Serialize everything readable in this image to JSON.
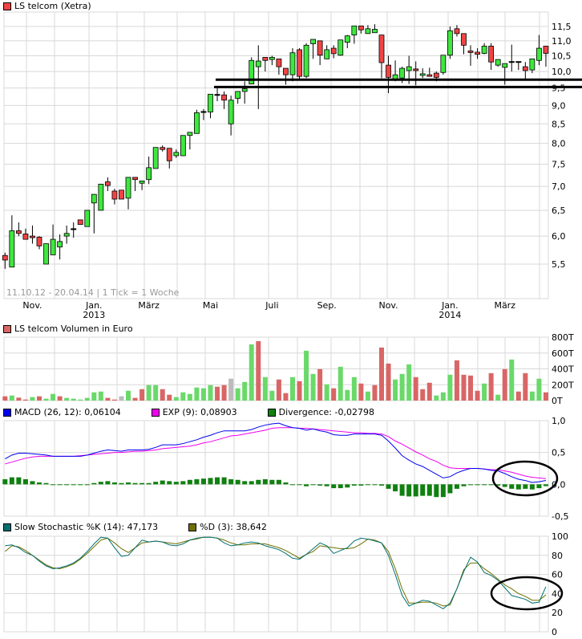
{
  "colors": {
    "up": "#3ee83e",
    "down": "#f04444",
    "vol_up": "#6ad96a",
    "vol_down": "#d96666",
    "vol_neutral": "#bbbbbb",
    "grid": "#d8d8d8",
    "macd": "#0000ee",
    "signal": "#ee00ee",
    "divergence": "#108010",
    "stoch_k": "#007070",
    "stoch_d": "#707000"
  },
  "chart_data": [
    {
      "type": "candlestick",
      "title": "LS telcom (Xetra)",
      "scale": "log",
      "ylim": [
        4.94,
        12.03
      ],
      "yticks": [
        "11,5",
        "11,0",
        "10,5",
        "10,0",
        "9,5",
        "9,0",
        "8,5",
        "8,0",
        "7,5",
        "7,0",
        "6,5",
        "6,0",
        "5,5"
      ],
      "ytick_values": [
        11.5,
        11.0,
        10.5,
        10.0,
        9.5,
        9.0,
        8.5,
        8.0,
        7.5,
        7.0,
        6.5,
        6.0,
        5.5
      ],
      "x_labels": [
        [
          "Nov.",
          ""
        ],
        [
          "Jan.",
          "2013"
        ],
        [
          "März",
          ""
        ],
        [
          "Mai",
          ""
        ],
        [
          "Juli",
          ""
        ],
        [
          "Sep.",
          ""
        ],
        [
          "Nov.",
          ""
        ],
        [
          "Jan.",
          "2014"
        ],
        [
          "März",
          ""
        ]
      ],
      "x_label_weeks": [
        4,
        13,
        21,
        30,
        39,
        47,
        56,
        65,
        73
      ],
      "range_note": "11.10.12 - 20.04.14 | 1 Tick = 1 Woche",
      "grid": true,
      "support_lines": [
        9.75,
        9.53
      ],
      "ohlc": [
        [
          5.65,
          5.7,
          5.42,
          5.57
        ],
        [
          5.45,
          6.4,
          5.45,
          6.1
        ],
        [
          6.1,
          6.26,
          6.0,
          6.05
        ],
        [
          6.04,
          6.14,
          5.94,
          5.94
        ],
        [
          6.0,
          6.2,
          5.86,
          5.98
        ],
        [
          5.98,
          6.0,
          5.76,
          5.82
        ],
        [
          5.5,
          5.86,
          5.5,
          5.86
        ],
        [
          5.66,
          6.22,
          5.66,
          5.94
        ],
        [
          5.8,
          6.03,
          5.58,
          5.9
        ],
        [
          6.0,
          6.2,
          5.86,
          6.05
        ],
        [
          6.13,
          6.26,
          5.97,
          6.13
        ],
        [
          6.31,
          6.31,
          6.22,
          6.22
        ],
        [
          6.18,
          6.5,
          6.18,
          6.5
        ],
        [
          6.65,
          6.83,
          6.05,
          6.83
        ],
        [
          6.5,
          7.05,
          6.5,
          7.05
        ],
        [
          7.1,
          7.2,
          6.9,
          7.02
        ],
        [
          6.9,
          6.95,
          6.62,
          6.73
        ],
        [
          6.92,
          6.92,
          6.73,
          6.73
        ],
        [
          6.75,
          7.2,
          6.52,
          7.2
        ],
        [
          7.2,
          7.2,
          6.9,
          7.15
        ],
        [
          7.07,
          7.12,
          6.92,
          7.12
        ],
        [
          7.15,
          7.68,
          7.05,
          7.42
        ],
        [
          7.4,
          7.9,
          7.4,
          7.9
        ],
        [
          7.9,
          7.95,
          7.8,
          7.85
        ],
        [
          7.88,
          7.88,
          7.4,
          7.58
        ],
        [
          7.7,
          7.85,
          7.65,
          7.78
        ],
        [
          7.7,
          8.2,
          7.7,
          8.2
        ],
        [
          8.2,
          8.28,
          7.85,
          8.28
        ],
        [
          8.25,
          8.88,
          8.25,
          8.8
        ],
        [
          8.82,
          8.9,
          8.6,
          8.82
        ],
        [
          8.82,
          9.32,
          8.65,
          9.32
        ],
        [
          9.3,
          9.5,
          9.12,
          9.3
        ],
        [
          9.3,
          9.4,
          8.9,
          9.15
        ],
        [
          8.5,
          9.28,
          8.2,
          9.15
        ],
        [
          9.2,
          9.4,
          9.05,
          9.4
        ],
        [
          9.4,
          9.7,
          9.05,
          9.48
        ],
        [
          9.62,
          10.45,
          9.62,
          10.35
        ],
        [
          10.15,
          10.85,
          8.9,
          10.33
        ],
        [
          10.45,
          10.45,
          10.0,
          10.35
        ],
        [
          10.38,
          10.5,
          10.2,
          10.45
        ],
        [
          10.4,
          10.4,
          9.9,
          10.15
        ],
        [
          10.1,
          10.1,
          9.6,
          9.9
        ],
        [
          9.9,
          10.75,
          9.7,
          10.6
        ],
        [
          10.7,
          10.75,
          9.78,
          9.85
        ],
        [
          9.85,
          10.92,
          9.8,
          10.85
        ],
        [
          10.9,
          11.05,
          10.4,
          11.05
        ],
        [
          11.0,
          11.0,
          10.2,
          10.52
        ],
        [
          10.4,
          10.85,
          10.4,
          10.7
        ],
        [
          10.75,
          10.85,
          10.42,
          10.57
        ],
        [
          10.52,
          11.03,
          10.5,
          11.03
        ],
        [
          10.95,
          11.2,
          10.75,
          11.17
        ],
        [
          11.2,
          11.52,
          10.9,
          11.52
        ],
        [
          11.52,
          11.52,
          11.25,
          11.38
        ],
        [
          11.25,
          11.55,
          11.25,
          11.42
        ],
        [
          11.28,
          11.58,
          11.28,
          11.4
        ],
        [
          11.2,
          11.2,
          9.8,
          10.28
        ],
        [
          10.2,
          10.5,
          9.35,
          9.82
        ],
        [
          9.75,
          10.35,
          9.7,
          9.9
        ],
        [
          9.8,
          10.15,
          9.65,
          10.1
        ],
        [
          10.03,
          10.5,
          9.62,
          10.15
        ],
        [
          10.08,
          10.32,
          9.58,
          10.03
        ],
        [
          9.88,
          10.1,
          9.8,
          9.93
        ],
        [
          9.9,
          10.12,
          9.85,
          9.85
        ],
        [
          9.95,
          10.0,
          9.7,
          9.82
        ],
        [
          9.97,
          10.52,
          9.9,
          10.52
        ],
        [
          10.52,
          11.5,
          10.4,
          11.35
        ],
        [
          11.42,
          11.55,
          11.15,
          11.25
        ],
        [
          11.25,
          11.25,
          10.55,
          10.85
        ],
        [
          10.66,
          10.85,
          10.18,
          10.62
        ],
        [
          10.62,
          10.75,
          10.4,
          10.55
        ],
        [
          10.58,
          10.92,
          10.55,
          10.82
        ],
        [
          10.82,
          10.92,
          10.05,
          10.3
        ],
        [
          10.2,
          10.38,
          10.15,
          10.38
        ],
        [
          10.13,
          10.25,
          9.6,
          10.25
        ],
        [
          10.3,
          10.87,
          10.0,
          10.3
        ],
        [
          10.3,
          10.3,
          10.05,
          10.3
        ],
        [
          10.15,
          10.3,
          9.78,
          10.03
        ],
        [
          10.05,
          10.4,
          9.95,
          10.4
        ],
        [
          10.35,
          11.2,
          10.2,
          10.75
        ],
        [
          10.82,
          10.82,
          10.15,
          10.58
        ]
      ]
    },
    {
      "type": "bar",
      "title": "LS telcom Volumen in Euro",
      "ylim": [
        0,
        800
      ],
      "yticks": [
        "800T",
        "600T",
        "400T",
        "200T",
        "0T"
      ],
      "ytick_values": [
        800,
        600,
        400,
        200,
        0
      ],
      "grid": true,
      "values": [
        54,
        64,
        37,
        13,
        44,
        54,
        24,
        84,
        54,
        34,
        24,
        13,
        34,
        104,
        114,
        34,
        13,
        54,
        124,
        34,
        144,
        195,
        195,
        144,
        74,
        44,
        104,
        84,
        165,
        155,
        195,
        175,
        195,
        276,
        155,
        235,
        709,
        750,
        296,
        124,
        266,
        94,
        296,
        245,
        629,
        336,
        397,
        205,
        155,
        427,
        134,
        296,
        215,
        114,
        195,
        669,
        467,
        266,
        336,
        457,
        296,
        144,
        225,
        64,
        104,
        326,
        508,
        326,
        316,
        124,
        215,
        346,
        74,
        397,
        518,
        114,
        346,
        114,
        276,
        104
      ],
      "directions": [
        "down",
        "up",
        "down",
        "down",
        "up",
        "down",
        "up",
        "up",
        "down",
        "up",
        "up",
        "up",
        "up",
        "up",
        "up",
        "down",
        "down",
        "neutral",
        "up",
        "down",
        "down",
        "up",
        "up",
        "down",
        "down",
        "up",
        "up",
        "up",
        "up",
        "up",
        "up",
        "down",
        "down",
        "neutral",
        "up",
        "up",
        "up",
        "down",
        "up",
        "up",
        "down",
        "down",
        "up",
        "down",
        "up",
        "up",
        "down",
        "up",
        "down",
        "up",
        "up",
        "up",
        "down",
        "up",
        "down",
        "down",
        "down",
        "up",
        "up",
        "up",
        "down",
        "down",
        "down",
        "up",
        "up",
        "up",
        "down",
        "down",
        "down",
        "down",
        "up",
        "down",
        "up",
        "down",
        "up",
        "down",
        "down",
        "up",
        "up",
        "down"
      ]
    },
    {
      "type": "line",
      "ylim": [
        -0.5,
        1.0
      ],
      "yticks": [
        "1,0",
        "0,5",
        "0,0",
        "-0,5"
      ],
      "ytick_values": [
        1.0,
        0.5,
        0.0,
        -0.5
      ],
      "grid": true,
      "series": [
        {
          "name": "MACD (26, 12): 0,06104",
          "values": [
            0.4,
            0.46,
            0.49,
            0.49,
            0.48,
            0.47,
            0.46,
            0.44,
            0.44,
            0.44,
            0.44,
            0.44,
            0.46,
            0.49,
            0.52,
            0.54,
            0.53,
            0.52,
            0.54,
            0.54,
            0.54,
            0.55,
            0.58,
            0.62,
            0.62,
            0.62,
            0.64,
            0.67,
            0.7,
            0.74,
            0.77,
            0.81,
            0.84,
            0.84,
            0.84,
            0.84,
            0.86,
            0.9,
            0.93,
            0.95,
            0.96,
            0.92,
            0.89,
            0.88,
            0.85,
            0.87,
            0.84,
            0.82,
            0.78,
            0.77,
            0.77,
            0.79,
            0.79,
            0.79,
            0.79,
            0.77,
            0.68,
            0.57,
            0.45,
            0.38,
            0.32,
            0.28,
            0.22,
            0.16,
            0.1,
            0.12,
            0.18,
            0.22,
            0.25,
            0.25,
            0.24,
            0.22,
            0.21,
            0.17,
            0.12,
            0.08,
            0.06,
            0.03,
            0.04,
            0.061
          ]
        },
        {
          "name": "EXP (9): 0,08903",
          "values": [
            0.32,
            0.35,
            0.38,
            0.41,
            0.43,
            0.44,
            0.44,
            0.44,
            0.44,
            0.44,
            0.44,
            0.45,
            0.46,
            0.47,
            0.48,
            0.49,
            0.5,
            0.5,
            0.51,
            0.52,
            0.52,
            0.53,
            0.54,
            0.56,
            0.57,
            0.58,
            0.59,
            0.6,
            0.62,
            0.65,
            0.67,
            0.7,
            0.73,
            0.76,
            0.77,
            0.79,
            0.81,
            0.83,
            0.85,
            0.88,
            0.89,
            0.89,
            0.89,
            0.88,
            0.88,
            0.87,
            0.86,
            0.85,
            0.84,
            0.83,
            0.82,
            0.81,
            0.81,
            0.8,
            0.8,
            0.79,
            0.75,
            0.68,
            0.63,
            0.57,
            0.51,
            0.46,
            0.4,
            0.36,
            0.3,
            0.26,
            0.25,
            0.25,
            0.25,
            0.25,
            0.24,
            0.23,
            0.23,
            0.21,
            0.19,
            0.16,
            0.13,
            0.11,
            0.1,
            0.089
          ]
        },
        {
          "name": "Divergence: -0,02798",
          "type": "bar",
          "values": [
            0.08,
            0.11,
            0.11,
            0.08,
            0.05,
            0.03,
            0.02,
            0,
            0,
            0,
            0,
            -0.01,
            0,
            0.02,
            0.04,
            0.05,
            0.03,
            0.02,
            0.03,
            0.02,
            0.02,
            0.02,
            0.04,
            0.06,
            0.05,
            0.04,
            0.05,
            0.07,
            0.08,
            0.09,
            0.1,
            0.11,
            0.11,
            0.08,
            0.07,
            0.05,
            0.05,
            0.07,
            0.08,
            0.07,
            0.07,
            0.03,
            0,
            0,
            -0.03,
            0,
            -0.02,
            -0.03,
            -0.06,
            -0.06,
            -0.05,
            -0.02,
            -0.02,
            -0.01,
            -0.01,
            -0.02,
            -0.07,
            -0.11,
            -0.18,
            -0.19,
            -0.19,
            -0.18,
            -0.18,
            -0.2,
            -0.2,
            -0.14,
            -0.07,
            -0.03,
            0,
            0,
            0,
            -0.01,
            -0.02,
            -0.04,
            -0.07,
            -0.08,
            -0.07,
            -0.08,
            -0.06,
            -0.028
          ]
        }
      ]
    },
    {
      "type": "line",
      "ylim": [
        0,
        100
      ],
      "yticks": [
        "100",
        "80",
        "60",
        "40",
        "20",
        "0"
      ],
      "ytick_values": [
        100,
        80,
        60,
        40,
        20,
        0
      ],
      "grid": true,
      "series": [
        {
          "name": "Slow Stochastic %K (14): 47,173",
          "values": [
            90,
            91,
            88,
            83,
            80,
            74,
            69,
            66,
            67,
            69,
            72,
            77,
            84,
            92,
            99,
            98,
            88,
            79,
            80,
            88,
            96,
            94,
            95,
            94,
            91,
            90,
            92,
            96,
            98,
            99,
            99,
            98,
            93,
            90,
            91,
            93,
            94,
            93,
            90,
            88,
            86,
            82,
            77,
            76,
            81,
            87,
            93,
            90,
            82,
            85,
            88,
            95,
            98,
            97,
            95,
            93,
            80,
            60,
            38,
            27,
            30,
            33,
            32,
            28,
            24,
            30,
            45,
            63,
            78,
            73,
            62,
            59,
            54,
            46,
            38,
            36,
            34,
            30,
            31,
            47.2
          ]
        },
        {
          "name": "%D (3): 38,642",
          "values": [
            84,
            90,
            89,
            85,
            80,
            75,
            70,
            67,
            66,
            68,
            71,
            76,
            82,
            89,
            96,
            98,
            93,
            87,
            83,
            88,
            93,
            94,
            95,
            94,
            93,
            92,
            94,
            96,
            97,
            99,
            99,
            98,
            96,
            93,
            91,
            91,
            92,
            92,
            92,
            90,
            88,
            85,
            81,
            77,
            81,
            84,
            90,
            89,
            88,
            87,
            87,
            88,
            92,
            97,
            96,
            93,
            84,
            66,
            45,
            30,
            30,
            31,
            31,
            30,
            27,
            28,
            45,
            65,
            72,
            72,
            66,
            61,
            55,
            49,
            45,
            40,
            37,
            33,
            33,
            38.6
          ]
        }
      ]
    }
  ]
}
